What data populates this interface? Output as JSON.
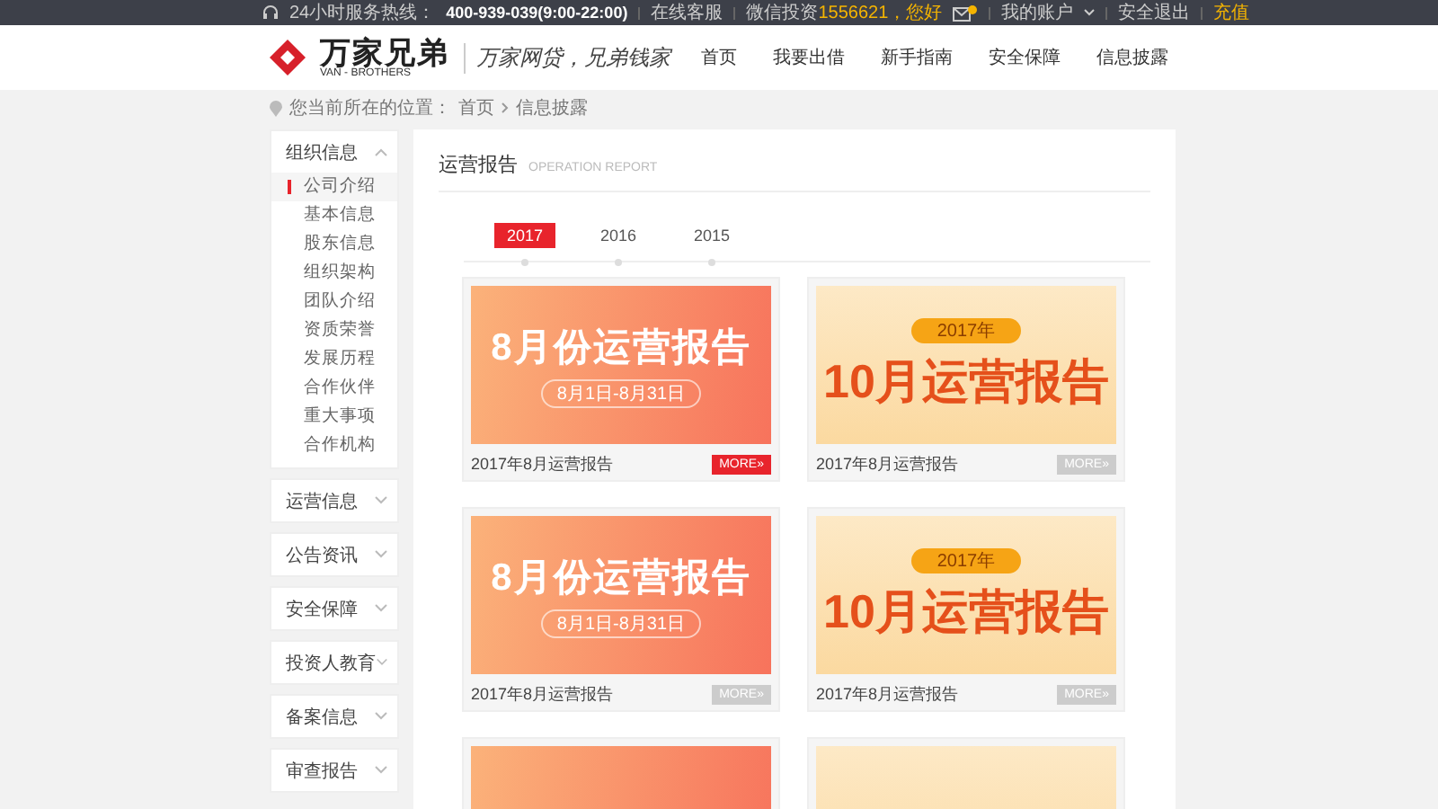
{
  "top_bar": {
    "hotline_label": "24小时服务热线：",
    "hotline": "400-939-039(9:00-22:00)",
    "links": [
      "在线客服",
      "微信投资"
    ],
    "greeting": "1556621，您好",
    "account": "我的账户",
    "logout": "安全退出",
    "recharge": "充值"
  },
  "header": {
    "logo_text": "万家兄弟",
    "logo_sub": "VAN - BROTHERS",
    "slogan": "万家网贷，兄弟钱家",
    "nav": [
      {
        "label": "首页",
        "selected": false
      },
      {
        "label": "我要出借",
        "selected": false
      },
      {
        "label": "新手指南",
        "selected": false
      },
      {
        "label": "安全保障",
        "selected": false
      },
      {
        "label": "信息披露",
        "selected": false
      }
    ]
  },
  "breadcrumb": {
    "label": "您当前所在的位置：",
    "path": [
      "首页"
    ],
    "current": "信息披露"
  },
  "sidebar": {
    "groups": [
      {
        "label": "组织信息",
        "expanded": true,
        "children": [
          {
            "label": "公司介绍",
            "selected": true
          },
          {
            "label": "基本信息",
            "selected": false
          },
          {
            "label": "股东信息",
            "selected": false
          },
          {
            "label": "组织架构",
            "selected": false
          },
          {
            "label": "团队介绍",
            "selected": false
          },
          {
            "label": "资质荣誉",
            "selected": false
          },
          {
            "label": "发展历程",
            "selected": false
          },
          {
            "label": "合作伙伴",
            "selected": false
          },
          {
            "label": "重大事项",
            "selected": false
          },
          {
            "label": "合作机构",
            "selected": false
          }
        ]
      },
      {
        "label": "运营信息",
        "expanded": false
      },
      {
        "label": "公告资讯",
        "expanded": false
      },
      {
        "label": "安全保障",
        "expanded": false
      },
      {
        "label": "投资人教育",
        "expanded": false
      },
      {
        "label": "备案信息",
        "expanded": false
      },
      {
        "label": "审查报告",
        "expanded": false
      }
    ]
  },
  "panel": {
    "title": "运营报告",
    "subtitle": "OPERATION REPORT",
    "years": [
      {
        "label": "2017",
        "selected": true
      },
      {
        "label": "2016",
        "selected": false
      },
      {
        "label": "2015",
        "selected": false
      }
    ],
    "reports": [
      {
        "kind": "orange",
        "banner_title": "8月份运营报告",
        "banner_dates": "8月1日-8月31日",
        "title": "2017年8月运营报告",
        "more": "MORE»",
        "active": true
      },
      {
        "kind": "cream",
        "banner_year": "2017年",
        "banner_title": "10月运营报告",
        "title": "2017年8月运营报告",
        "more": "MORE»",
        "active": false
      },
      {
        "kind": "orange",
        "banner_title": "8月份运营报告",
        "banner_dates": "8月1日-8月31日",
        "title": "2017年8月运营报告",
        "more": "MORE»",
        "active": false
      },
      {
        "kind": "cream",
        "banner_year": "2017年",
        "banner_title": "10月运营报告",
        "title": "2017年8月运营报告",
        "more": "MORE»",
        "active": false
      },
      {
        "kind": "orange"
      },
      {
        "kind": "cream"
      }
    ]
  }
}
